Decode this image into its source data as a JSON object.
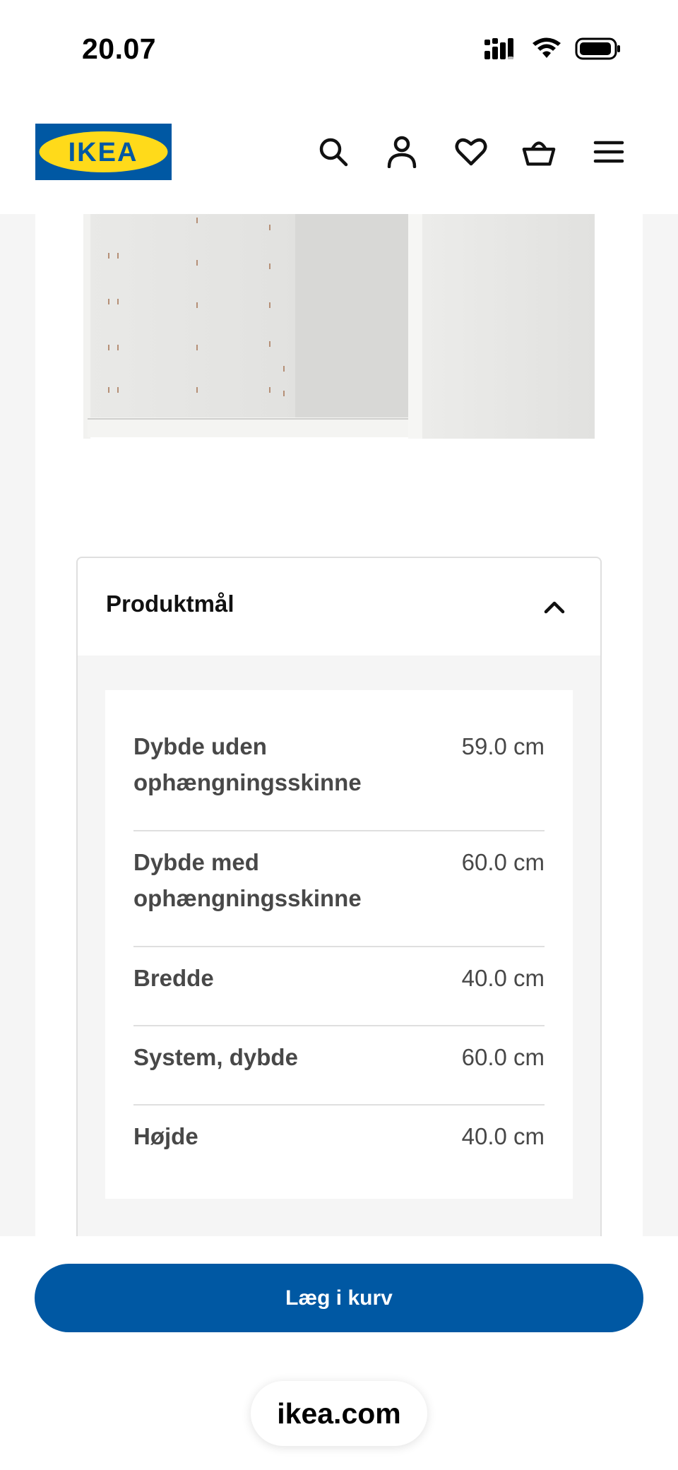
{
  "status_bar": {
    "time": "20.07"
  },
  "header": {
    "logo_text": "IKEA",
    "icons": [
      "search-icon",
      "user-icon",
      "heart-icon",
      "basket-icon",
      "menu-icon"
    ]
  },
  "accordion": {
    "title": "Produktmål",
    "expanded": true
  },
  "dimensions": [
    {
      "label": "Dybde uden ophængningsskinne",
      "value": "59.0 cm"
    },
    {
      "label": "Dybde med ophængningsskinne",
      "value": "60.0 cm"
    },
    {
      "label": "Bredde",
      "value": "40.0 cm"
    },
    {
      "label": "System, dybde",
      "value": "60.0 cm"
    },
    {
      "label": "Højde",
      "value": "40.0 cm"
    }
  ],
  "cart_button": {
    "label": "Læg i kurv"
  },
  "browser": {
    "url": "ikea.com"
  },
  "colors": {
    "brand_blue": "#0058a3",
    "logo_yellow": "#ffda1a",
    "logo_blue": "#0058a3"
  }
}
